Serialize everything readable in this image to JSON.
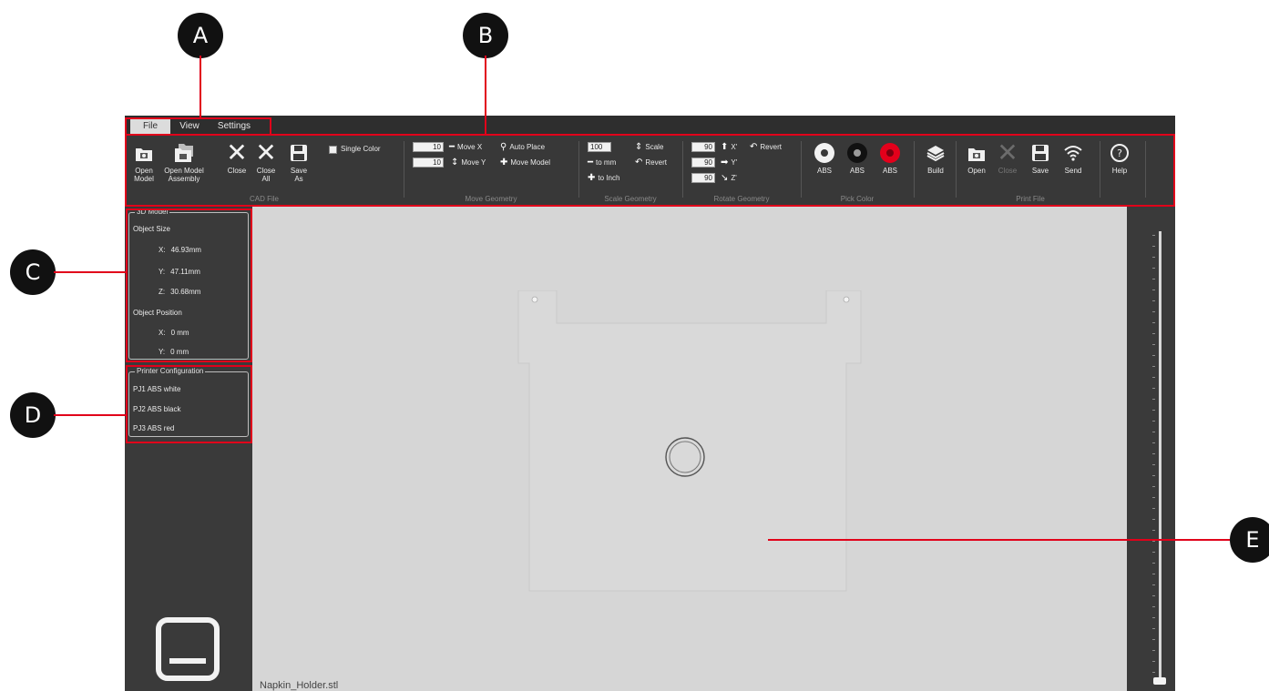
{
  "callouts": [
    "A",
    "B",
    "C",
    "D",
    "E"
  ],
  "menu": {
    "tabs": [
      "File",
      "View",
      "Settings"
    ],
    "active_tab": "File"
  },
  "ribbon": {
    "cad_file": {
      "group_label": "CAD File",
      "open_model": "Open\nModel",
      "open_model_assembly": "Open Model\nAssembly",
      "close": "Close",
      "close_all": "Close\nAll",
      "save_as": "Save\nAs",
      "single_color": "Single Color"
    },
    "move_geometry": {
      "group_label": "Move Geometry",
      "x_value": "10",
      "y_value": "10",
      "move_x": "Move X",
      "move_y": "Move Y",
      "auto_place": "Auto Place",
      "move_model": "Move Model"
    },
    "scale_geometry": {
      "group_label": "Scale Geometry",
      "scale_value": "100",
      "scale": "Scale",
      "to_mm": "to mm",
      "revert": "Revert",
      "to_inch": "to Inch"
    },
    "rotate_geometry": {
      "group_label": "Rotate Geometry",
      "x_value": "90",
      "y_value": "90",
      "z_value": "90",
      "x_label": "X'",
      "y_label": "Y'",
      "z_label": "Z'",
      "revert": "Revert"
    },
    "pick_color": {
      "group_label": "Pick Color",
      "swatches": [
        {
          "label": "ABS",
          "ring": "#f2f2f2",
          "center": "#383838"
        },
        {
          "label": "ABS",
          "ring": "#111111",
          "center": "#9a9a9a"
        },
        {
          "label": "ABS",
          "ring": "#e3001b",
          "center": "#7a0010"
        }
      ]
    },
    "build": {
      "label": "Build"
    },
    "print_file": {
      "group_label": "Print File",
      "open": "Open",
      "close": "Close",
      "save": "Save",
      "send": "Send"
    },
    "help": {
      "label": "Help"
    }
  },
  "model_panel": {
    "legend": "3D Model",
    "object_size_title": "Object Size",
    "size": {
      "x_label": "X:",
      "x_value": "46.93mm",
      "y_label": "Y:",
      "y_value": "47.11mm",
      "z_label": "Z:",
      "z_value": "30.68mm"
    },
    "object_position_title": "Object Position",
    "position": {
      "x_label": "X:",
      "x_value": "0 mm",
      "y_label": "Y:",
      "y_value": "0 mm"
    }
  },
  "printer_panel": {
    "legend": "Printer Configuration",
    "items": [
      "PJ1 ABS white",
      "PJ2 ABS black",
      "PJ3 ABS red"
    ]
  },
  "viewport": {
    "filename": "Napkin_Holder.stl"
  },
  "colors": {
    "callout_line": "#e1001a",
    "app_bg": "#3a3a3a",
    "viewport_bg": "#d6d6d6"
  }
}
